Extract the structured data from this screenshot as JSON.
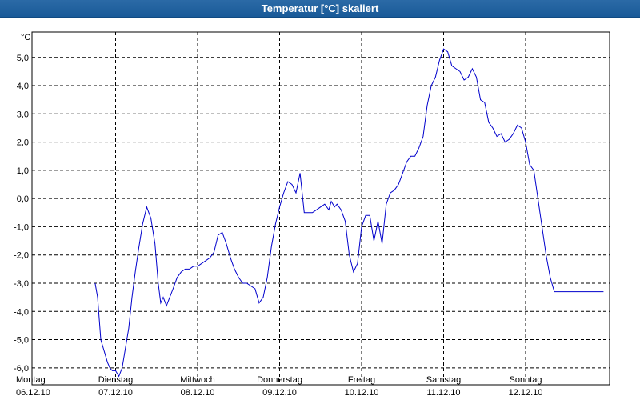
{
  "window": {
    "title": "Temperatur [°C] skaliert"
  },
  "chart_data": {
    "type": "line",
    "title": "Temperatur [°C] skaliert",
    "ylabel": "°C",
    "xlabel": "",
    "ylim": [
      -6.6,
      5.9
    ],
    "yticks": [
      -6,
      -5,
      -4,
      -3,
      -2,
      -1,
      0,
      1,
      2,
      3,
      4,
      5
    ],
    "ytick_labels": [
      "-6,0",
      "-5,0",
      "-4,0",
      "-3,0",
      "-2,0",
      "-1,0",
      "0,0",
      "1,0",
      "2,0",
      "3,0",
      "4,0",
      "5,0"
    ],
    "xlim_days": [
      0,
      7
    ],
    "xticks": [
      {
        "day": "Montag",
        "date": "06.12.10"
      },
      {
        "day": "Dienstag",
        "date": "07.12.10"
      },
      {
        "day": "Mittwoch",
        "date": "08.12.10"
      },
      {
        "day": "Donnerstag",
        "date": "09.12.10"
      },
      {
        "day": "Freitag",
        "date": "10.12.10"
      },
      {
        "day": "Samstag",
        "date": "11.12.10"
      },
      {
        "day": "Sonntag",
        "date": "12.12.10"
      }
    ],
    "grid": true,
    "line_color": "#0000cc",
    "series": [
      {
        "x": [
          0.75,
          0.78,
          0.82,
          0.85,
          0.87,
          0.9,
          0.93,
          0.96,
          1.0,
          1.04,
          1.08,
          1.12,
          1.16,
          1.2,
          1.24,
          1.28,
          1.33,
          1.38,
          1.43,
          1.48,
          1.52,
          1.55,
          1.58,
          1.62,
          1.66,
          1.7,
          1.75,
          1.8,
          1.85,
          1.9,
          1.95,
          2.0,
          2.05,
          2.1,
          2.15,
          2.2,
          2.25,
          2.3,
          2.35,
          2.4,
          2.45,
          2.5,
          2.55,
          2.6,
          2.65,
          2.7,
          2.75,
          2.8,
          2.85,
          2.9,
          2.95,
          3.0,
          3.05,
          3.1,
          3.15,
          3.2,
          3.25,
          3.3,
          3.35,
          3.4,
          3.45,
          3.5,
          3.55,
          3.6,
          3.63,
          3.67,
          3.7,
          3.75,
          3.8,
          3.85,
          3.9,
          3.95,
          4.0,
          4.05,
          4.1,
          4.15,
          4.2,
          4.25,
          4.3,
          4.35,
          4.4,
          4.45,
          4.5,
          4.55,
          4.6,
          4.65,
          4.7,
          4.75,
          4.8,
          4.85,
          4.9,
          4.95,
          5.0,
          5.05,
          5.1,
          5.15,
          5.2,
          5.25,
          5.3,
          5.35,
          5.4,
          5.45,
          5.5,
          5.55,
          5.6,
          5.65,
          5.7,
          5.75,
          5.8,
          5.85,
          5.9,
          5.95,
          6.0,
          6.05,
          6.1,
          6.15,
          6.2,
          6.25,
          6.3,
          6.35,
          6.4,
          6.45,
          6.5,
          6.55,
          6.6,
          6.65,
          6.7,
          6.75,
          6.8,
          6.85,
          6.9,
          6.95
        ],
        "values": [
          -3.0,
          -3.5,
          -5.0,
          -5.3,
          -5.5,
          -5.8,
          -6.0,
          -6.1,
          -6.1,
          -6.3,
          -6.0,
          -5.3,
          -4.6,
          -3.5,
          -2.6,
          -1.8,
          -0.9,
          -0.3,
          -0.7,
          -1.6,
          -3.0,
          -3.7,
          -3.5,
          -3.8,
          -3.5,
          -3.2,
          -2.8,
          -2.6,
          -2.5,
          -2.5,
          -2.4,
          -2.4,
          -2.3,
          -2.2,
          -2.1,
          -1.9,
          -1.3,
          -1.2,
          -1.6,
          -2.1,
          -2.5,
          -2.8,
          -3.0,
          -3.0,
          -3.1,
          -3.2,
          -3.7,
          -3.5,
          -2.8,
          -1.7,
          -0.9,
          -0.3,
          0.2,
          0.6,
          0.5,
          0.2,
          0.9,
          -0.5,
          -0.5,
          -0.5,
          -0.4,
          -0.3,
          -0.2,
          -0.4,
          -0.1,
          -0.3,
          -0.2,
          -0.4,
          -0.8,
          -2.0,
          -2.6,
          -2.3,
          -1.0,
          -0.6,
          -0.6,
          -1.5,
          -0.8,
          -1.6,
          -0.2,
          0.2,
          0.3,
          0.5,
          0.9,
          1.3,
          1.5,
          1.5,
          1.8,
          2.2,
          3.3,
          4.0,
          4.3,
          4.9,
          5.3,
          5.2,
          4.7,
          4.6,
          4.5,
          4.2,
          4.3,
          4.6,
          4.3,
          3.5,
          3.4,
          2.7,
          2.5,
          2.2,
          2.3,
          2.0,
          2.1,
          2.3,
          2.6,
          2.5,
          2.0,
          1.2,
          1.0,
          0.0,
          -1.0,
          -2.0,
          -2.8,
          -3.3,
          -3.3,
          -3.3,
          -3.3,
          -3.3,
          -3.3,
          -3.3,
          -3.3,
          -3.3,
          -3.3,
          -3.3,
          -3.3,
          -3.3
        ]
      }
    ]
  }
}
